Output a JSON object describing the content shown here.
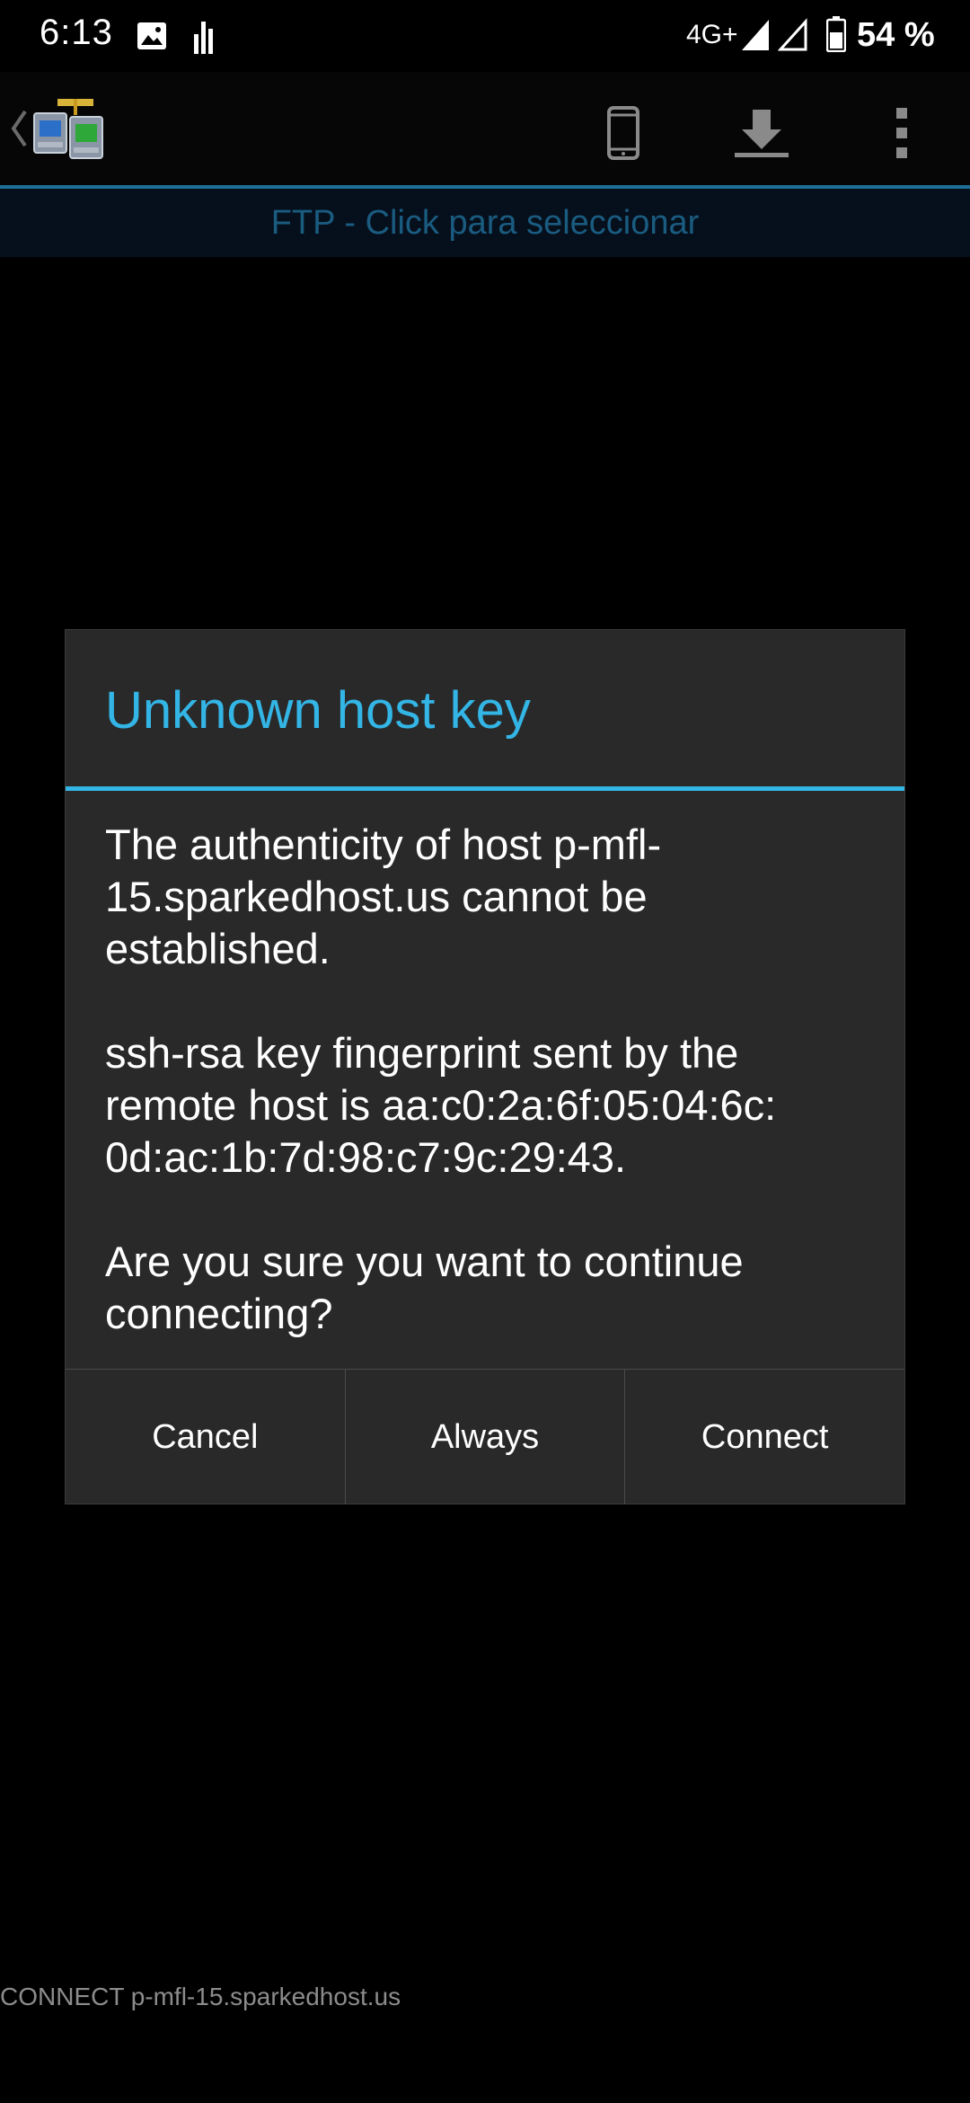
{
  "status_bar": {
    "time": "6:13",
    "network_type": "4G+",
    "battery": "54 %",
    "icons": [
      "gallery-icon",
      "data-usage-icon",
      "signal-icon",
      "signal-icon",
      "battery-icon"
    ]
  },
  "action_bar": {
    "icons": [
      "back-chevron-icon",
      "app-logo-icon",
      "phone-icon",
      "download-icon",
      "overflow-menu-icon"
    ]
  },
  "selector": {
    "label": "FTP - Click para seleccionar"
  },
  "dialog": {
    "title": "Unknown host key",
    "message_1": "The authenticity of host p-mfl-15.sparkedhost.us cannot be established.",
    "message_2": "ssh-rsa key fingerprint sent by the remote host is aa:c0:2a:6f:05:04:6c:\n0d:ac:1b:7d:98:c7:9c:29:43.",
    "message_3": "Are you sure you want to continue connecting?",
    "buttons": {
      "cancel": "Cancel",
      "always": "Always",
      "connect": "Connect"
    }
  },
  "footer": {
    "connect_status": "CONNECT p-mfl-15.sparkedhost.us"
  },
  "colors": {
    "accent": "#33b5e5",
    "selector_text": "#1a5b80",
    "dialog_bg": "#292929"
  }
}
